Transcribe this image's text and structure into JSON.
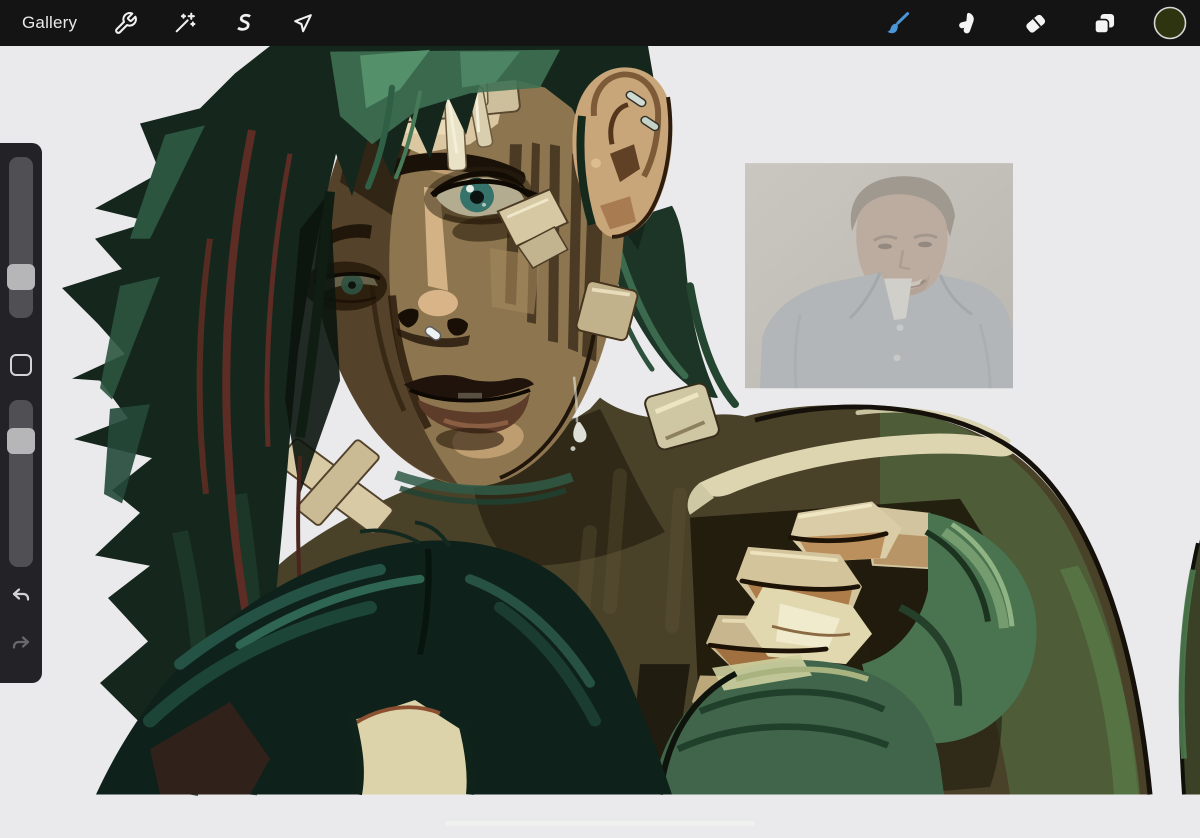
{
  "toolbar": {
    "gallery_label": "Gallery",
    "background": "#141414",
    "left_tools": [
      {
        "name": "actions",
        "icon": "wrench-icon"
      },
      {
        "name": "adjustments",
        "icon": "magic-wand-icon"
      },
      {
        "name": "selection",
        "icon": "selection-s-icon"
      },
      {
        "name": "transform",
        "icon": "transform-arrow-icon"
      }
    ],
    "right_tools": [
      {
        "name": "paint",
        "icon": "brush-icon",
        "active": true
      },
      {
        "name": "smudge",
        "icon": "smudge-finger-icon",
        "active": false
      },
      {
        "name": "erase",
        "icon": "eraser-icon",
        "active": false
      },
      {
        "name": "layers",
        "icon": "layers-icon",
        "active": false
      },
      {
        "name": "color",
        "icon": "color-swatch",
        "active": false
      }
    ]
  },
  "colors": {
    "accent_blue": "#4a97d8",
    "current_color": "#2e3310",
    "canvas_background": "#eaeaec",
    "sidebar_background": "#232327"
  },
  "sidebar": {
    "brush_size_percent": 72,
    "brush_opacity_percent": 20,
    "controls": [
      "brush-size-slider",
      "modify-button",
      "brush-opacity-slider",
      "undo-button",
      "redo-button"
    ]
  },
  "canvas": {
    "artwork_description": "Digital painting: green-haired fighter with bandaged face, nose ring and ear piercings, clenched fist in green hand wraps, second dark-teal-haired figure in foreground",
    "reference_image_description": "Faded reference photo of a smiling man in a blue-grey button-up shirt",
    "home_indicator": true
  }
}
